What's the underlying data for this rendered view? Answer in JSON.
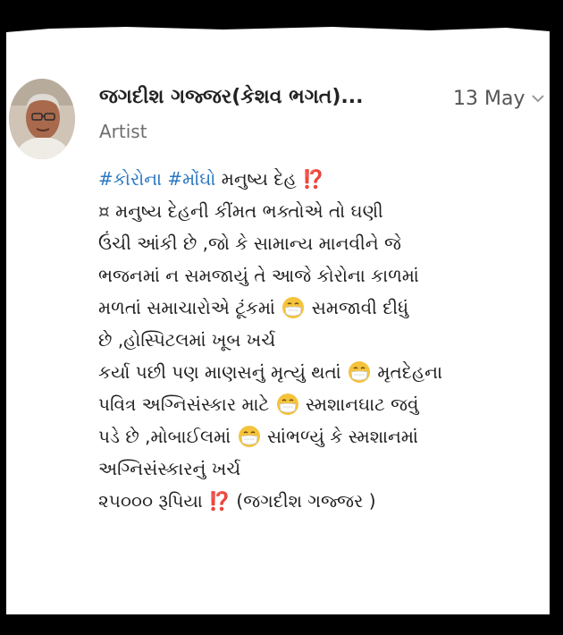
{
  "header": {
    "name": "જગદીશ ગજ્જર(કેશવ ભગત)...",
    "date": "13 May",
    "role": "Artist"
  },
  "post": {
    "line1": {
      "tag1": "#કોરોના",
      "tag2": "#મોંઘો",
      "text": "મનુષ્ય દેહ",
      "mark": "⁉️"
    },
    "line2": {
      "bullet": "¤",
      "text": "મનુષ્ય દેહની કીંમત ભક્તોએ તો ઘણી"
    },
    "line3": "ઉંચી આંકી છે ,જો કે સામાન્ય માનવીને જે",
    "line4": "ભજનમાં ન સમજાયું  તે આજે કોરોના કાળમાં",
    "line5": {
      "before": "મળતાં સમાચારોએ ટૂંકમાં",
      "after": "સમજાવી દીધું"
    },
    "line6": "છે ,હોસ્પિટલમાં ખૂબ ખર્ચ",
    "line7": {
      "before": "કર્યા પછી પણ માણસનું મૃત્યું થતાં",
      "after": "મૃતદેહના"
    },
    "line8": {
      "before": "પવિત્ર અગ્નિસંસ્કાર માટે",
      "after": "સ્મશાનઘાટ જવું"
    },
    "line9": {
      "before": "પડે છે ,મોબાઈલમાં",
      "after": "સાંભળ્યું કે સ્મશાનમાં"
    },
    "line10": "અગ્નિસંસ્કારનું ખર્ચ",
    "line11": {
      "before": "૨૫૦૦૦ રૂપિયા",
      "mark": "⁉️",
      "after": "(જગદીશ ગજ્જર )"
    }
  },
  "icons": {
    "mask_emoji": "face-with-medical-mask-icon",
    "chevron": "chevron-down-icon"
  },
  "colors": {
    "hashtag": "#2a78c2",
    "interrobang": "#e0302a",
    "background": "#000000",
    "card": "#ffffff"
  }
}
